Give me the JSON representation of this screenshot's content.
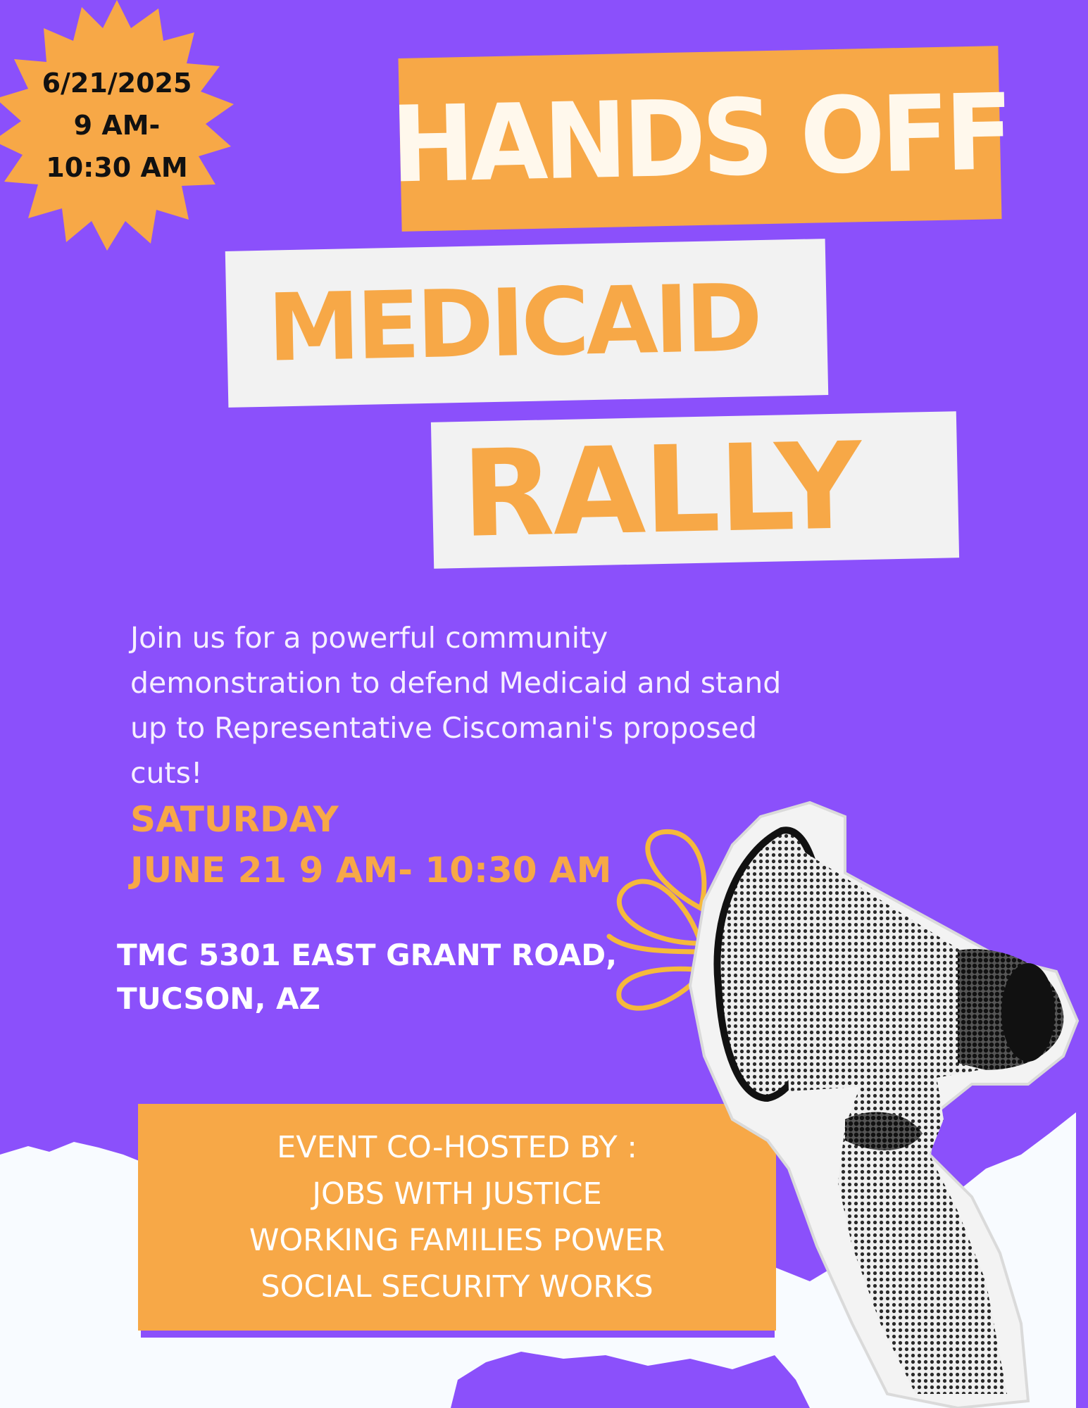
{
  "colors": {
    "background": "#8b50fb",
    "accent_orange": "#f7a847",
    "paper_white": "#f2f2f2",
    "text_white": "#ffffff"
  },
  "badge": {
    "date": "6/21/2025",
    "time_line1": "9 AM-",
    "time_line2": "10:30 AM"
  },
  "headline": {
    "line1": "HANDS OFF",
    "line2": "MEDICAID",
    "line3": "RALLY"
  },
  "intro": {
    "line1": "Join us for a powerful community",
    "line2": "demonstration to defend Medicaid and stand",
    "line3": "up to Representative Ciscomani's proposed",
    "line4": "cuts!"
  },
  "schedule": {
    "day": "SATURDAY",
    "date_time": "JUNE 21 9 AM- 10:30 AM"
  },
  "address": {
    "line1": "TMC 5301 EAST GRANT ROAD,",
    "line2": "TUCSON, AZ"
  },
  "hosts": {
    "heading": "EVENT CO-HOSTED BY :",
    "items": [
      "JOBS WITH JUSTICE",
      "WORKING FAMILIES POWER",
      "SOCIAL SECURITY WORKS"
    ]
  },
  "icons": {
    "badge": "starburst-icon",
    "illustration": "megaphone-icon"
  }
}
